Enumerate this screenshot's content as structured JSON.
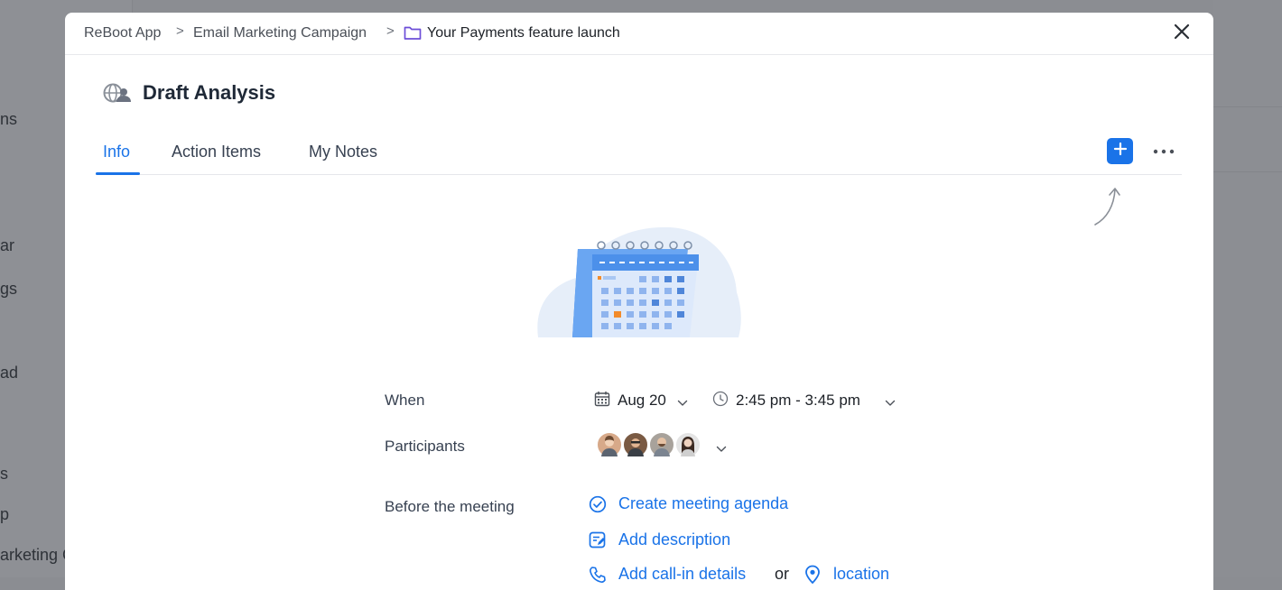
{
  "background": {
    "sidebar_items": [
      "ns",
      "ar",
      "gs",
      "ad",
      "s",
      "p",
      "arketing C"
    ]
  },
  "breadcrumb": {
    "items": [
      "ReBoot App",
      "Email Marketing Campaign",
      "Your Payments feature launch"
    ],
    "separator": ">"
  },
  "meeting": {
    "title": "Draft Analysis"
  },
  "tabs": [
    {
      "label": "Info",
      "active": true
    },
    {
      "label": "Action Items",
      "active": false
    },
    {
      "label": "My Notes",
      "active": false
    }
  ],
  "details": {
    "when_label": "When",
    "date": "Aug 20",
    "time": "2:45 pm - 3:45 pm",
    "participants_label": "Participants",
    "before_label": "Before the meeting",
    "actions": {
      "agenda": "Create meeting agenda",
      "description": "Add description",
      "callin": "Add call-in details",
      "or": "or",
      "location": "location"
    }
  },
  "colors": {
    "accent": "#1a73e8",
    "folder": "#6c4ed8",
    "highlight_day": "#f28b2a"
  },
  "icons": [
    "globe-people-icon",
    "folder-icon",
    "close-icon",
    "plus-icon",
    "more-horizontal-icon",
    "calendar-icon",
    "clock-icon",
    "chevron-down-icon",
    "check-circle-icon",
    "edit-note-icon",
    "phone-icon",
    "location-pin-icon"
  ]
}
